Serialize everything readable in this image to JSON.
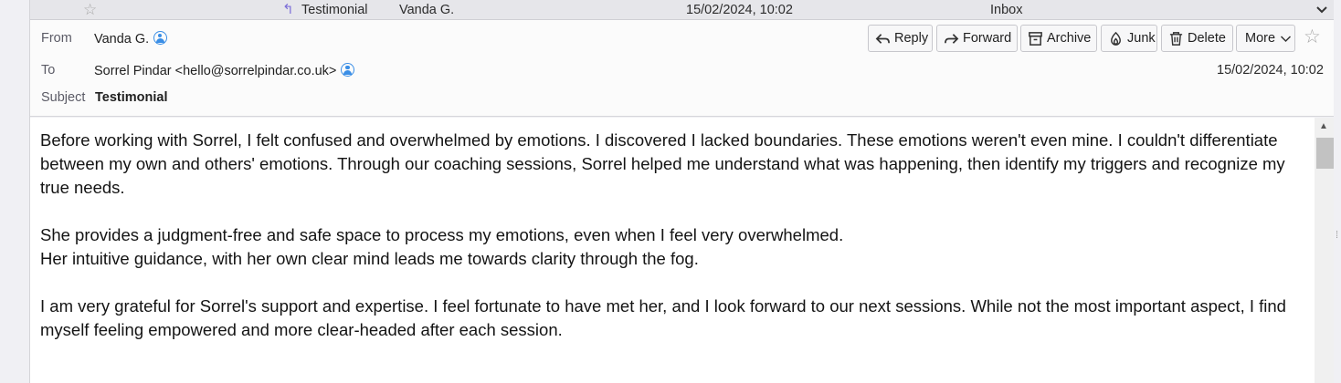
{
  "message_list_row": {
    "subject": "Testimonial",
    "sender": "Vanda G.",
    "date": "15/02/2024, 10:02",
    "folder": "Inbox"
  },
  "header": {
    "from_label": "From",
    "from_value": "Vanda G.",
    "to_label": "To",
    "to_value": "Sorrel Pindar <hello@sorrelpindar.co.uk>",
    "subject_label": "Subject",
    "subject_value": "Testimonial",
    "date": "15/02/2024, 10:02"
  },
  "toolbar": {
    "reply": "Reply",
    "forward": "Forward",
    "archive": "Archive",
    "junk": "Junk",
    "delete": "Delete",
    "more": "More"
  },
  "icons": {
    "star": "star-icon",
    "reply": "reply-icon",
    "forward": "forward-icon",
    "archive": "archive-icon",
    "junk": "junk-icon",
    "delete": "trash-icon",
    "contact": "contact-icon"
  },
  "colors": {
    "accent": "#3a8ee6",
    "reply_indicator": "#7d6fd8"
  },
  "body": {
    "paragraph_1": "Before working with Sorrel, I felt confused and overwhelmed by emotions. I discovered I lacked boundaries. These emotions weren't even mine. I couldn't differentiate between my own and others' emotions. Through our coaching sessions, Sorrel helped me understand what was happening, then identify my triggers and recognize my true needs.",
    "paragraph_2_line_1": "She provides a judgment-free and safe space to process my emotions, even when I feel very overwhelmed.",
    "paragraph_2_line_2": "Her intuitive guidance, with her own clear mind leads me towards clarity through the fog.",
    "paragraph_3": "I am very grateful for Sorrel's support and expertise. I feel fortunate to have met her, and I look forward to our next sessions. While not the most important aspect, I find myself feeling empowered and more clear-headed after each session."
  }
}
